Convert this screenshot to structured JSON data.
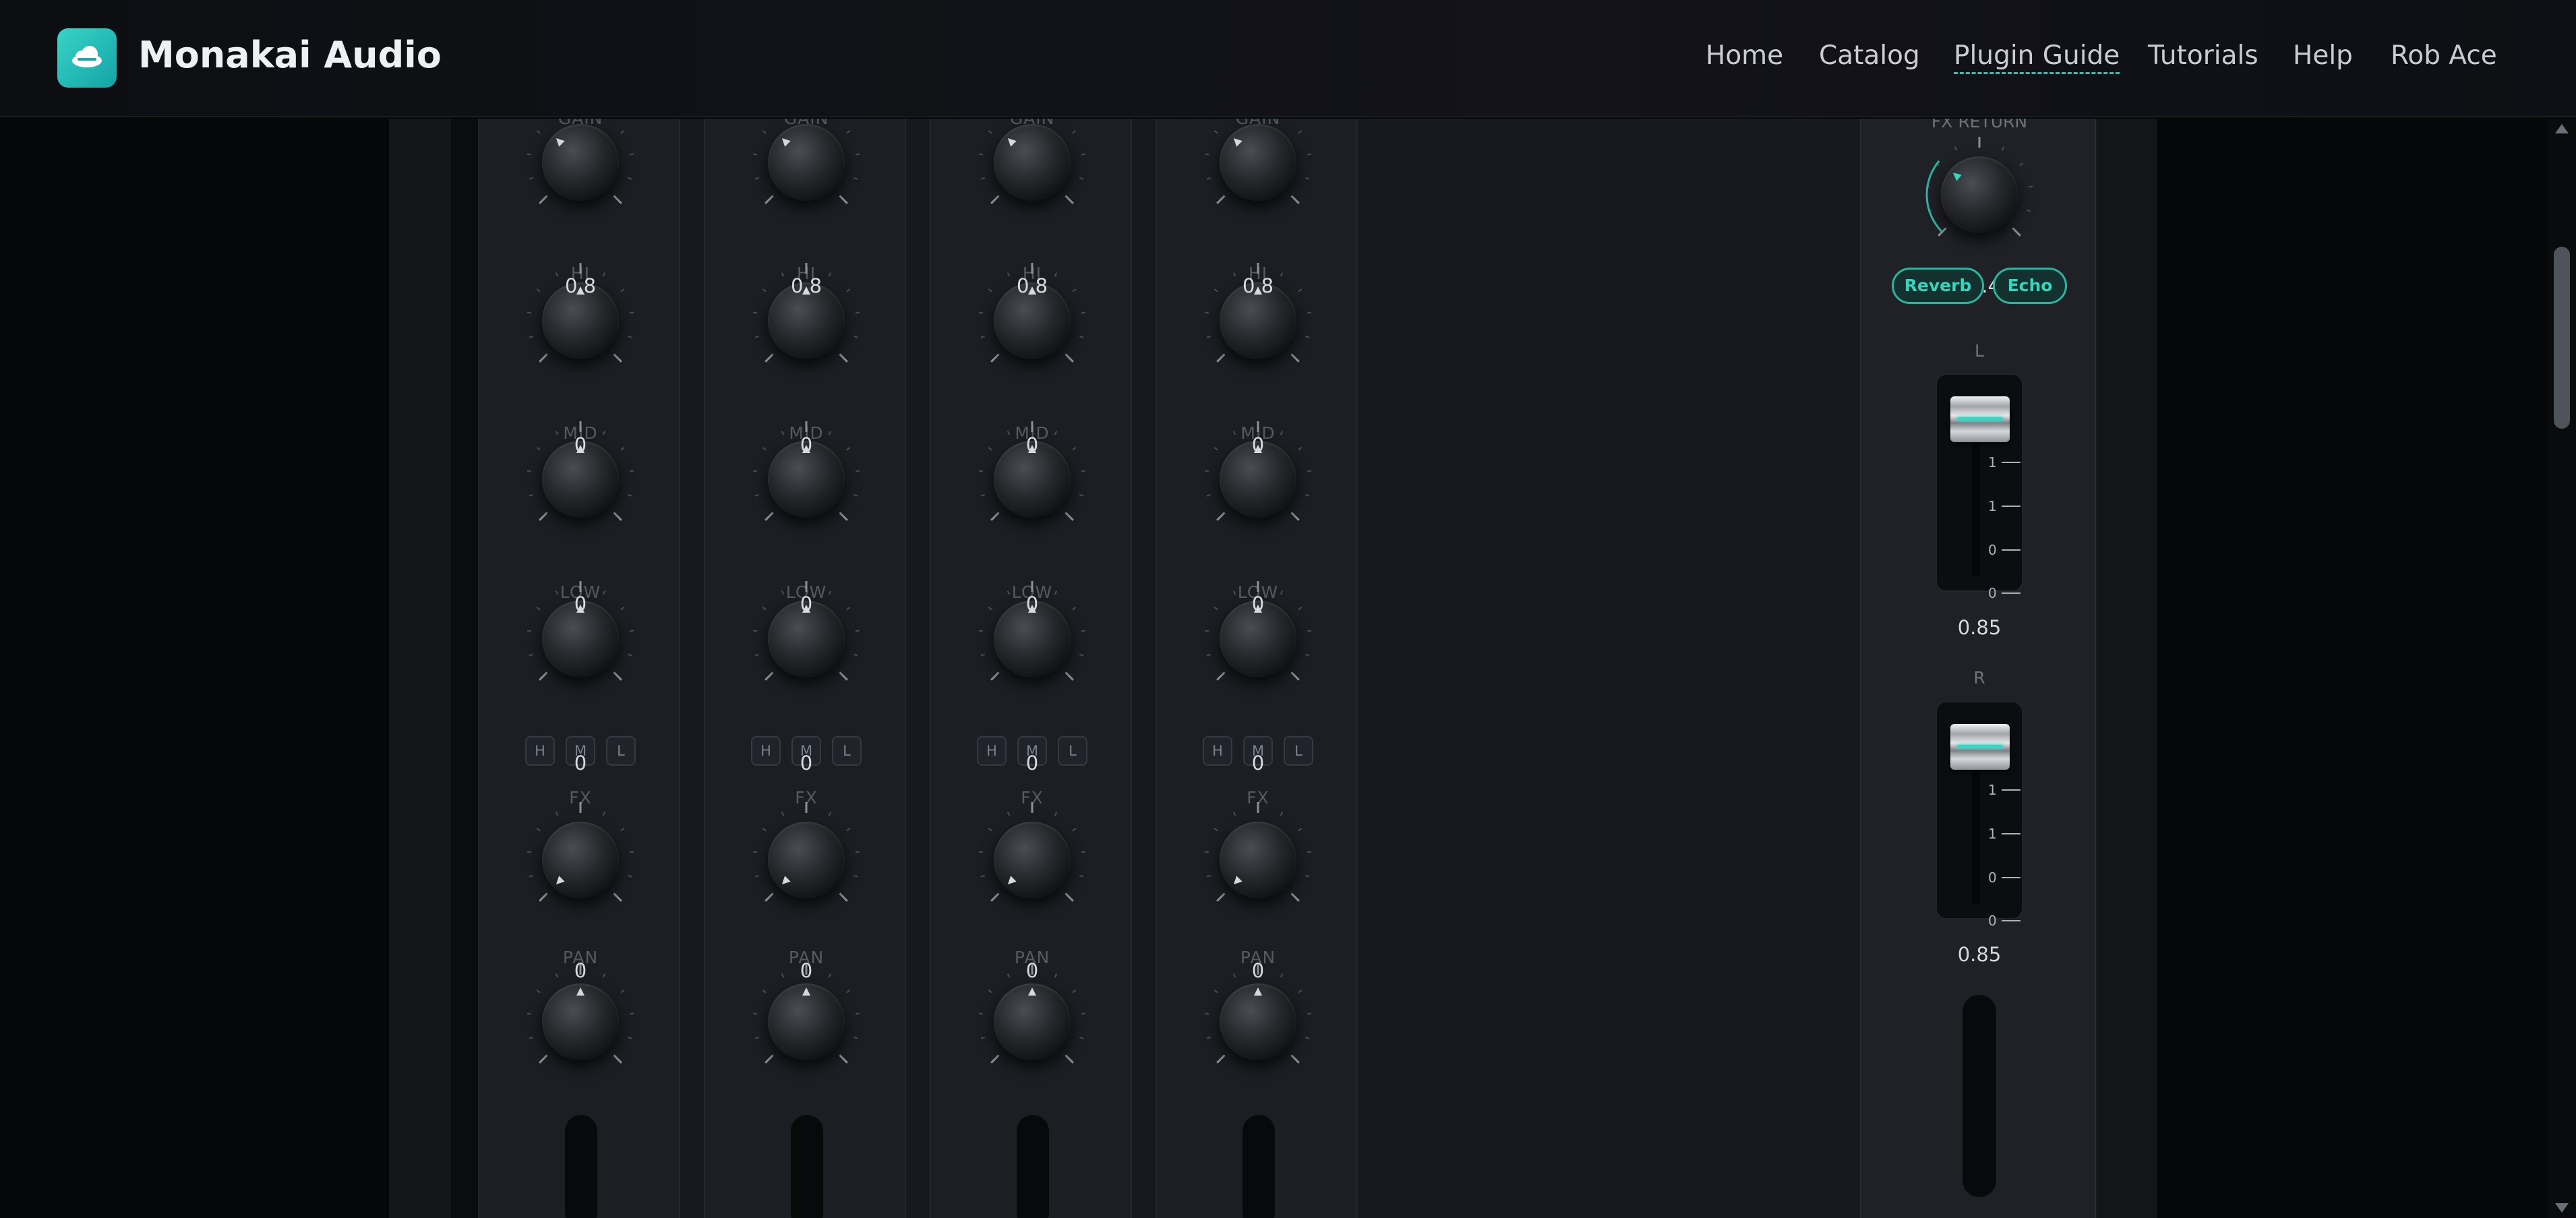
{
  "header": {
    "brand": "Monakai Audio",
    "nav": [
      "Home",
      "Catalog",
      "Plugin Guide",
      "Tutorials",
      "Help",
      "Rob Ace"
    ]
  },
  "channels": [
    {
      "gain_label": "GAIN",
      "gain_value": "",
      "hi_label": "HI",
      "hi_value": "0.8",
      "mid_label": "MID",
      "mid_value": "0",
      "low_label": "LOW",
      "low_value": "0",
      "eq_buttons": [
        "H",
        "M",
        "L"
      ],
      "eq_value": "0",
      "fx_label": "FX",
      "pan_label": "PAN",
      "pan_value": "0"
    },
    {
      "gain_label": "GAIN",
      "gain_value": "",
      "hi_label": "HI",
      "hi_value": "0.8",
      "mid_label": "MID",
      "mid_value": "0",
      "low_label": "LOW",
      "low_value": "0",
      "eq_buttons": [
        "H",
        "M",
        "L"
      ],
      "eq_value": "0",
      "fx_label": "FX",
      "pan_label": "PAN",
      "pan_value": "0"
    },
    {
      "gain_label": "GAIN",
      "gain_value": "",
      "hi_label": "HI",
      "hi_value": "0.8",
      "mid_label": "MID",
      "mid_value": "0",
      "low_label": "LOW",
      "low_value": "0",
      "eq_buttons": [
        "H",
        "M",
        "L"
      ],
      "eq_value": "0",
      "fx_label": "FX",
      "pan_label": "PAN",
      "pan_value": "0"
    },
    {
      "gain_label": "GAIN",
      "gain_value": "",
      "hi_label": "HI",
      "hi_value": "0.8",
      "mid_label": "MID",
      "mid_value": "0",
      "low_label": "LOW",
      "low_value": "0",
      "eq_buttons": [
        "H",
        "M",
        "L"
      ],
      "eq_value": "0",
      "fx_label": "FX",
      "pan_label": "PAN",
      "pan_value": "0"
    }
  ],
  "fx_return": {
    "label": "FX RETURN",
    "value": "0.4",
    "buttons": [
      "Reverb",
      "Echo"
    ],
    "left_label": "L",
    "right_label": "R",
    "left_value": "0.85",
    "right_value": "0.85",
    "scale": [
      "1",
      "1",
      "0",
      "0"
    ]
  },
  "colors": {
    "accent": "#2ec4b3",
    "background": "#060708",
    "console": "#17191e"
  },
  "icons": {
    "logo": "cloud-disc-icon"
  }
}
